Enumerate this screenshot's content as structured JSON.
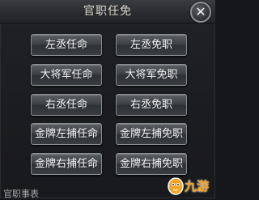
{
  "dialog": {
    "title": "官职任免",
    "close_symbol": "✕"
  },
  "buttons": [
    "左丞任命",
    "左丞免职",
    "大将军任命",
    "大将军免职",
    "右丞任命",
    "右丞免职",
    "金牌左捕任命",
    "金牌左捕免职",
    "金牌右捕任命",
    "金牌右捕免职"
  ],
  "footer": {
    "text": "官职事表"
  },
  "watermark": {
    "brand": "九游"
  },
  "colors": {
    "accent_orange": "#f3a322",
    "button_border": "#8a8d92",
    "text": "#f2f2f2"
  }
}
